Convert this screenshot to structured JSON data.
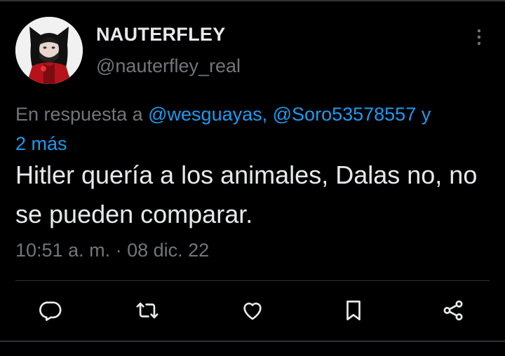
{
  "colors": {
    "background": "#000000",
    "primary_text": "#e7e9ea",
    "secondary_text": "#71767b",
    "link": "#1d9bf0",
    "divider": "#2f3336"
  },
  "author": {
    "display_name": "NAUTERFLEY",
    "handle": "@nauterfley_real"
  },
  "reply": {
    "prefix": "En respuesta a ",
    "mention_1": "@wesguayas,",
    "mention_2": "@Soro53578557",
    "connector": " y",
    "more": "2 más"
  },
  "tweet": {
    "text": "Hitler quería a los animales, Dalas no, no se pueden comparar.",
    "timestamp": "10:51 a. m. · 08 dic. 22"
  },
  "actions": [
    {
      "icon": "reply-icon"
    },
    {
      "icon": "retweet-icon"
    },
    {
      "icon": "like-icon"
    },
    {
      "icon": "bookmark-icon"
    },
    {
      "icon": "share-icon"
    }
  ]
}
